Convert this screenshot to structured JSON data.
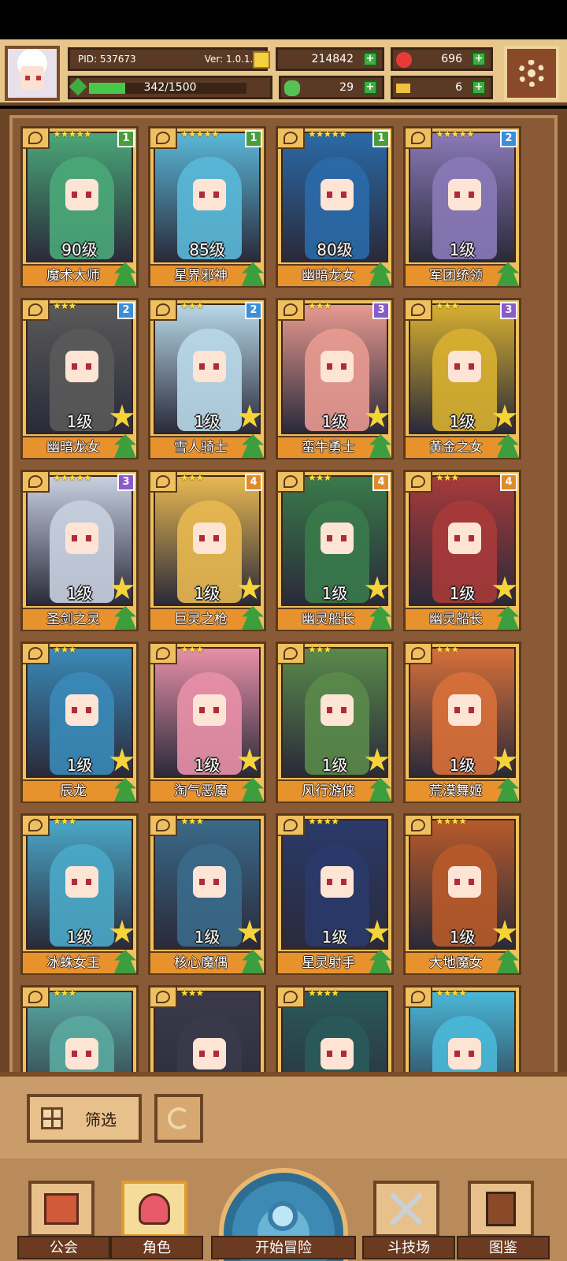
{
  "player": {
    "pid": "PID: 537673",
    "version": "Ver: 1.0.1.2",
    "exp": "342/1500",
    "exp_progress": 0.228
  },
  "resources": {
    "gold": "214842",
    "gems": "696",
    "clover": "29",
    "keys": "6"
  },
  "colors": {
    "badge_green": "#4a9e3a",
    "badge_blue": "#3b8ed8",
    "badge_purple": "#8a5cc8",
    "badge_orange": "#e08a2a"
  },
  "cards": [
    {
      "name": "魔术大师",
      "level": "90级",
      "badge": "1",
      "stars": "★★★★★",
      "tint": "#4aa878"
    },
    {
      "name": "星界邪神",
      "level": "85级",
      "badge": "1",
      "stars": "★★★★★",
      "tint": "#5ab8d8"
    },
    {
      "name": "幽暗龙女",
      "level": "80级",
      "badge": "1",
      "stars": "★★★★★",
      "tint": "#2a6aa8"
    },
    {
      "name": "军团统领",
      "level": "1级",
      "badge": "2",
      "stars": "★★★★★",
      "tint": "#8a7ab8"
    },
    {
      "name": "幽暗龙女",
      "level": "1级",
      "badge": "2",
      "stars": "★★★",
      "tint": "#5a5a5a"
    },
    {
      "name": "雪人骑士",
      "level": "1级",
      "badge": "2",
      "stars": "★★★",
      "tint": "#b8d8e8"
    },
    {
      "name": "蛮牛勇士",
      "level": "1级",
      "badge": "3",
      "stars": "★★★",
      "tint": "#e89a90"
    },
    {
      "name": "黄金之女",
      "level": "1级",
      "badge": "3",
      "stars": "★★★",
      "tint": "#d8b030"
    },
    {
      "name": "圣剑之灵",
      "level": "1级",
      "badge": "3",
      "stars": "★★★★★",
      "tint": "#c8d0e0"
    },
    {
      "name": "巨灵之枪",
      "level": "1级",
      "badge": "4",
      "stars": "★★★",
      "tint": "#e8b850"
    },
    {
      "name": "幽灵船长",
      "level": "1级",
      "badge": "4",
      "stars": "★★★",
      "tint": "#3a7a4a"
    },
    {
      "name": "幽灵船长",
      "level": "1级",
      "badge": "4",
      "stars": "★★★",
      "tint": "#a83a3a"
    },
    {
      "name": "辰龙",
      "level": "1级",
      "badge": "",
      "stars": "★★★",
      "tint": "#3a8ab8"
    },
    {
      "name": "淘气恶魔",
      "level": "1级",
      "badge": "",
      "stars": "★★★",
      "tint": "#e890a8"
    },
    {
      "name": "风行游侠",
      "level": "1级",
      "badge": "",
      "stars": "★★★",
      "tint": "#5a8a4a"
    },
    {
      "name": "荒漠舞姬",
      "level": "1级",
      "badge": "",
      "stars": "★★★",
      "tint": "#d8703a"
    },
    {
      "name": "冰蛛女王",
      "level": "1级",
      "badge": "",
      "stars": "★★★",
      "tint": "#4aa8c8"
    },
    {
      "name": "核心魔偶",
      "level": "1级",
      "badge": "",
      "stars": "★★★",
      "tint": "#3a6a8a"
    },
    {
      "name": "星灵射手",
      "level": "1级",
      "badge": "",
      "stars": "★★★★",
      "tint": "#2a3a6a"
    },
    {
      "name": "大地魔女",
      "level": "1级",
      "badge": "",
      "stars": "★★★★",
      "tint": "#b85a2a"
    },
    {
      "name": "",
      "level": "",
      "badge": "",
      "stars": "★★★",
      "tint": "#5aa8a0"
    },
    {
      "name": "",
      "level": "",
      "badge": "",
      "stars": "★★★",
      "tint": "#3a3a4a"
    },
    {
      "name": "",
      "level": "",
      "badge": "",
      "stars": "★★★★",
      "tint": "#2a5a5a"
    },
    {
      "name": "",
      "level": "",
      "badge": "",
      "stars": "★★★★",
      "tint": "#4ab8d8"
    }
  ],
  "filter": {
    "label": "筛选"
  },
  "nav": {
    "guild": "公会",
    "character": "角色",
    "adventure": "开始冒险",
    "arena": "斗技场",
    "codex": "图鉴"
  }
}
